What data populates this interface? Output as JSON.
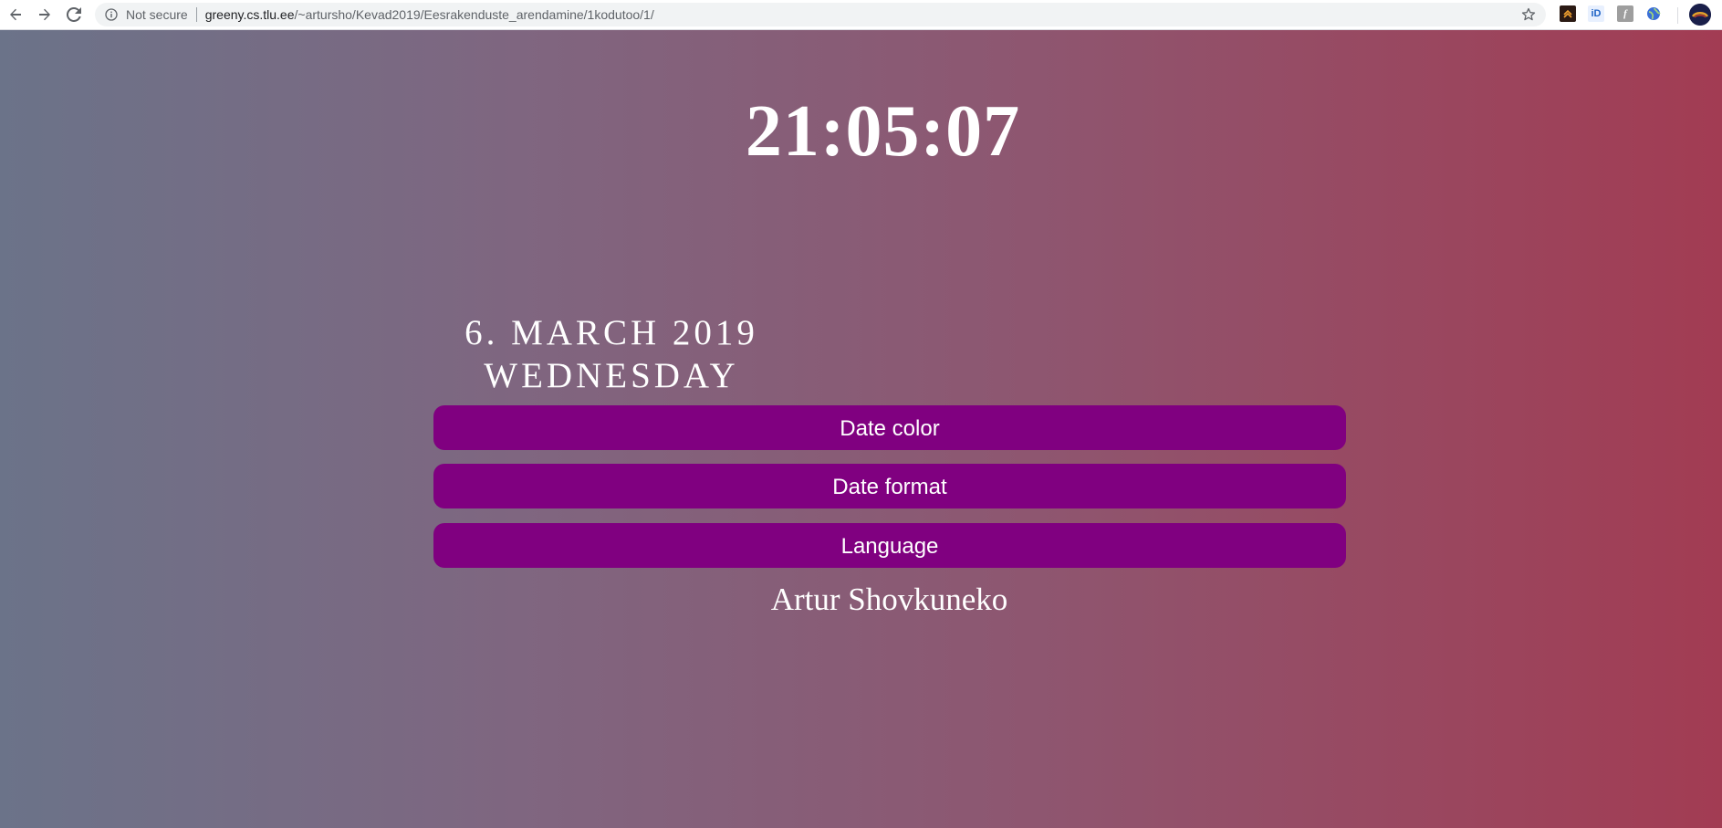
{
  "browser": {
    "security_label": "Not secure",
    "url_host": "greeny.cs.tlu.ee",
    "url_path": "/~artursho/Kevad2019/Eesrakenduste_arendamine/1kodutoo/1/",
    "extensions": [
      {
        "icon": "chevron-up-extension-icon",
        "color": "#2b1a14"
      },
      {
        "icon": "id-extension-icon",
        "color": "#1e63c5"
      },
      {
        "icon": "font-extension-icon",
        "color": "#9e9e9e"
      },
      {
        "icon": "globe-extension-icon",
        "color": "#3b6fd6"
      }
    ]
  },
  "clock": {
    "time": "21:05:07"
  },
  "date": {
    "line1": "6. MARCH 2019",
    "line2": "WEDNESDAY"
  },
  "buttons": {
    "date_color": "Date color",
    "date_format": "Date format",
    "language": "Language"
  },
  "author": "Artur Shovkuneko",
  "colors": {
    "button_bg": "#800080",
    "gradient_left": "#6b7389",
    "gradient_right": "#a23c53",
    "text": "#ffffff"
  }
}
